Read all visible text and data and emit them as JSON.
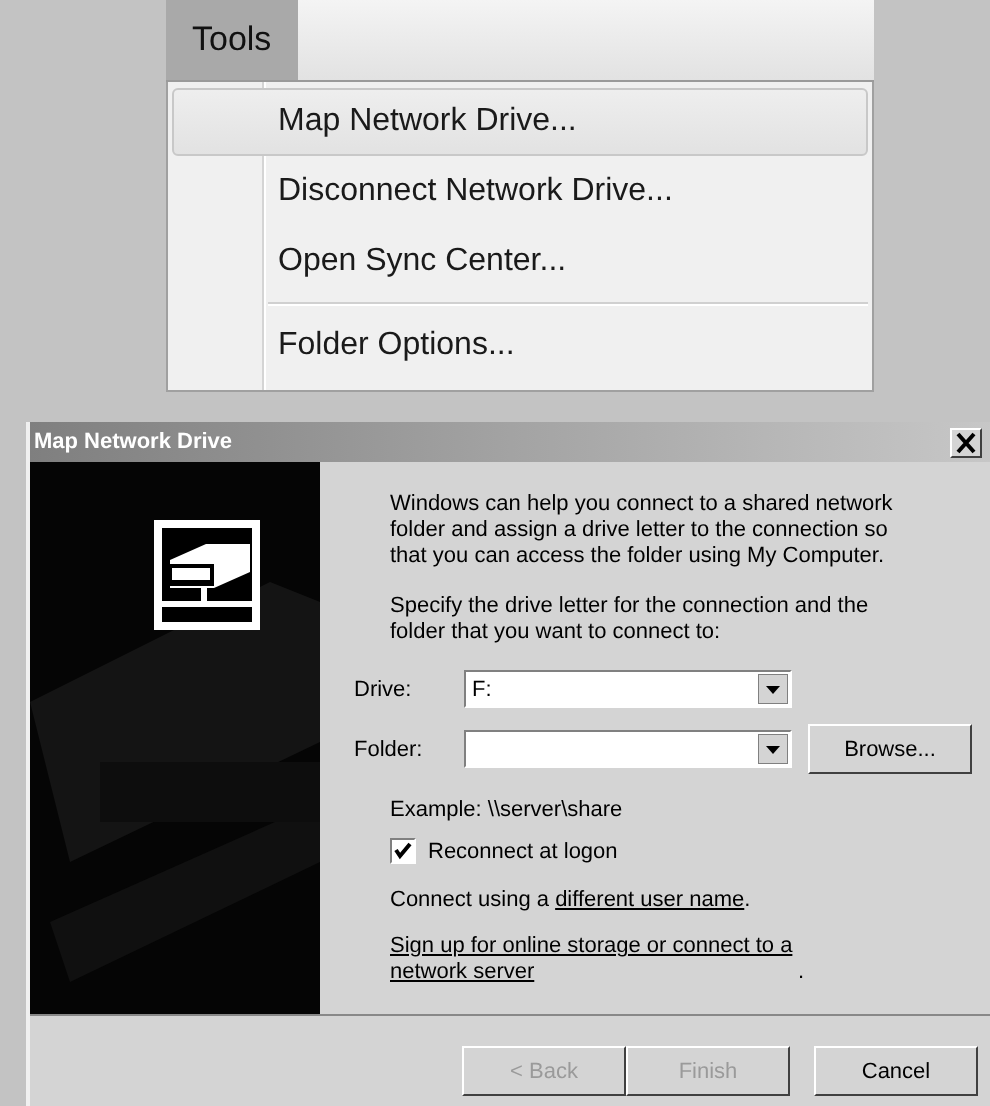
{
  "menu_bar": {
    "title": "Tools",
    "selected": true
  },
  "menu": {
    "items": [
      {
        "label": "Map Network Drive...",
        "selected": true,
        "separator_before": false
      },
      {
        "label": "Disconnect Network Drive...",
        "selected": false,
        "separator_before": false
      },
      {
        "label": "Open Sync Center...",
        "selected": false,
        "separator_before": false
      },
      {
        "label": "Folder Options...",
        "selected": false,
        "separator_before": true
      }
    ]
  },
  "dialog": {
    "title": "Map Network Drive",
    "intro": "Windows can help you connect to a shared network folder and assign a drive letter to the connection so that you can access the folder using My Computer.",
    "instruction": "Specify the drive letter for the connection and the folder that you want to connect to:",
    "fields": [
      {
        "label": "Drive:",
        "value": "F:"
      },
      {
        "label": "Folder:"
      }
    ],
    "browse_button": "Browse...",
    "example": "Example: \\\\server\\share",
    "reconnect": {
      "label": "Reconnect at logon",
      "checked": true
    },
    "links": [
      {
        "prefix": "Connect using a ",
        "link": "different user name",
        "suffix": "."
      },
      {
        "link": "Sign up for online storage or connect to a network server",
        "suffix": "."
      }
    ],
    "buttons": [
      {
        "label": "< Back",
        "disabled": true
      },
      {
        "label": "Finish",
        "disabled": true
      },
      {
        "label": "Cancel",
        "disabled": false
      }
    ]
  }
}
